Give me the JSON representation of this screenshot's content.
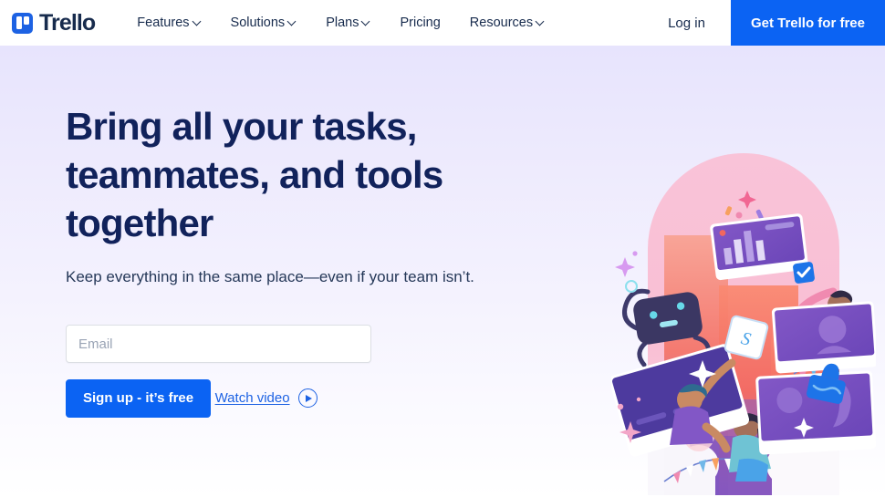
{
  "header": {
    "brand": {
      "name": "Trello",
      "logo_icon": "trello-logo-icon"
    },
    "nav_items": [
      {
        "label": "Features",
        "has_dropdown": true
      },
      {
        "label": "Solutions",
        "has_dropdown": true
      },
      {
        "label": "Plans",
        "has_dropdown": true
      },
      {
        "label": "Pricing",
        "has_dropdown": false
      },
      {
        "label": "Resources",
        "has_dropdown": true
      }
    ],
    "login_label": "Log in",
    "cta_label": "Get Trello for free"
  },
  "hero": {
    "headline": "Bring all your tasks, teammates, and tools together",
    "subhead": "Keep everything in the same place—even if your team isn’t.",
    "email_placeholder": "Email",
    "email_value": "",
    "signup_label": "Sign up - it’s free",
    "watch_video_label": "Watch video",
    "play_icon": "play-icon"
  },
  "colors": {
    "brand_blue": "#0b63f3",
    "logo_blue": "#1d62e3",
    "headline_navy": "#11225b",
    "text_navy": "#172b4d",
    "link_blue": "#1d62e3",
    "hero_gradient_top": "#e7e4fd",
    "hero_gradient_bottom": "#ffffff",
    "input_border": "#dcdfe4",
    "placeholder_gray": "#9aa4b5"
  },
  "illustration": {
    "name": "teamwork-hero-illustration",
    "description": "Pink arch backdrop with robot, people on purple cards, bunting flags and clouds"
  }
}
